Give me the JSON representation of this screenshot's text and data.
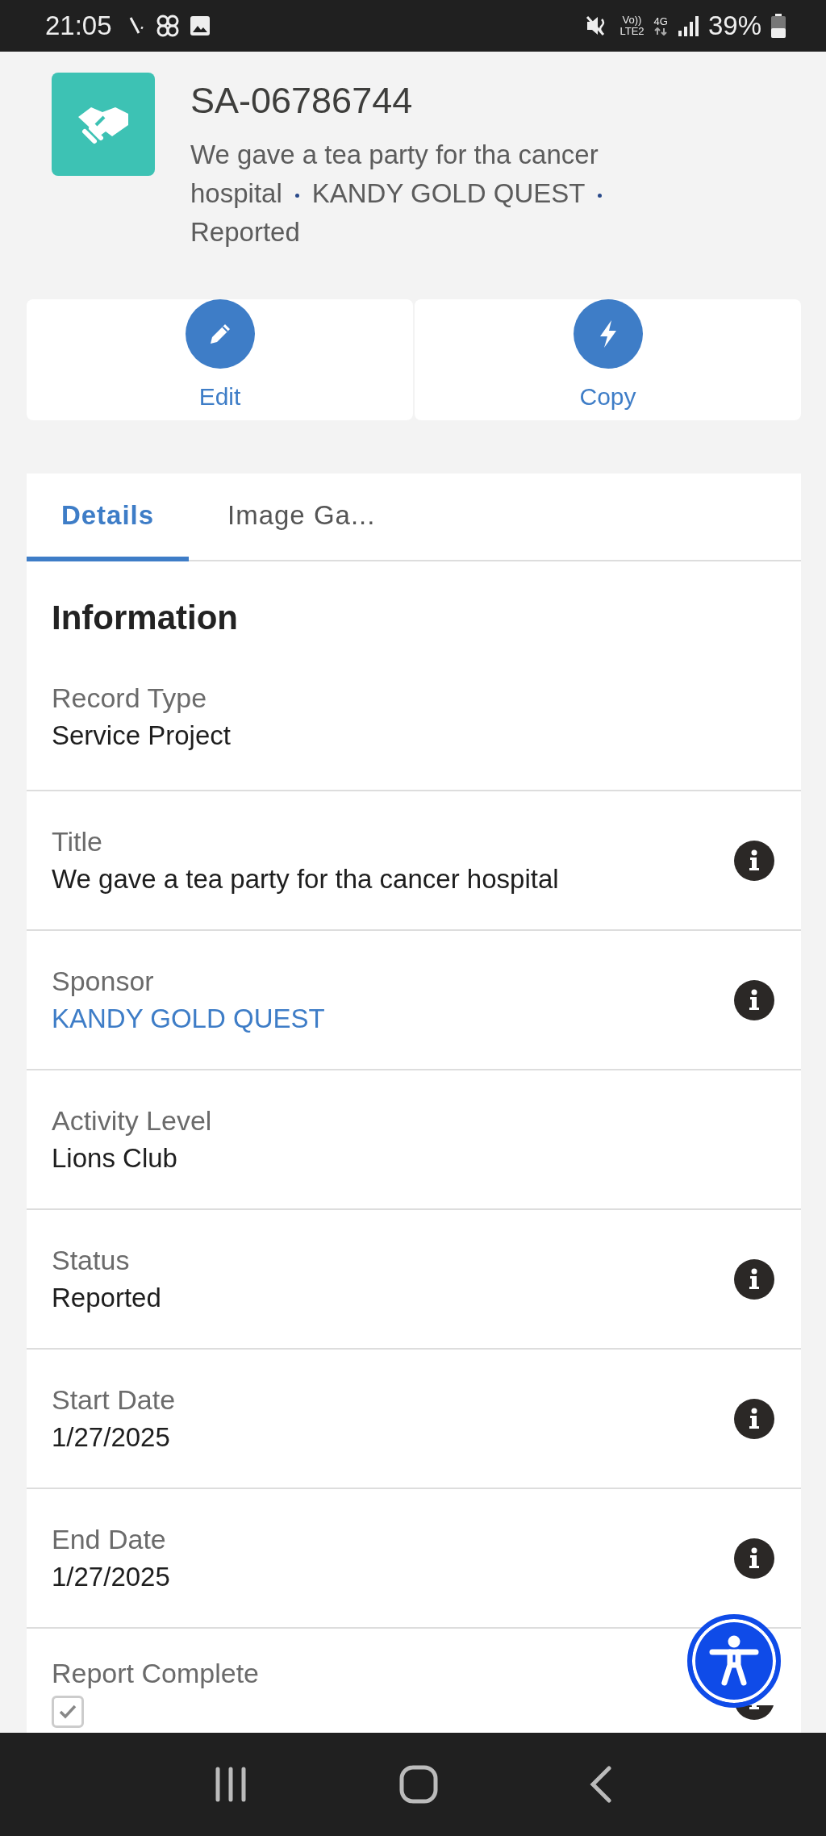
{
  "status_bar": {
    "time": "21:05",
    "volte": "Vo))",
    "lte": "LTE2",
    "network": "4G",
    "battery": "39%"
  },
  "record": {
    "number": "SA-06786744",
    "subtitle_parts": [
      "We gave a tea party for tha cancer hospital",
      "KANDY GOLD QUEST",
      "Reported"
    ]
  },
  "actions": [
    {
      "label": "Edit",
      "kind": "edit"
    },
    {
      "label": "Copy",
      "kind": "bolt"
    }
  ],
  "tabs": [
    {
      "label": "Details",
      "selected": true
    },
    {
      "label": "Image Ga...",
      "selected": false
    }
  ],
  "section": {
    "title": "Information"
  },
  "fields": [
    {
      "label": "Record Type",
      "value": "Service Project",
      "kind": "text",
      "info": false
    },
    {
      "label": "Title",
      "value": "We gave a tea party for tha cancer hospital",
      "kind": "text",
      "info": true
    },
    {
      "label": "Sponsor",
      "value": "KANDY GOLD QUEST",
      "kind": "link",
      "info": true
    },
    {
      "label": "Activity Level",
      "value": "Lions Club",
      "kind": "text",
      "info": false
    },
    {
      "label": "Status",
      "value": "Reported",
      "kind": "text",
      "info": true
    },
    {
      "label": "Start Date",
      "value": "1/27/2025",
      "kind": "text",
      "info": true
    },
    {
      "label": "End Date",
      "value": "1/27/2025",
      "kind": "text",
      "info": true
    },
    {
      "label": "Report Complete",
      "kind": "checkbox",
      "checked": true,
      "info": true
    }
  ]
}
